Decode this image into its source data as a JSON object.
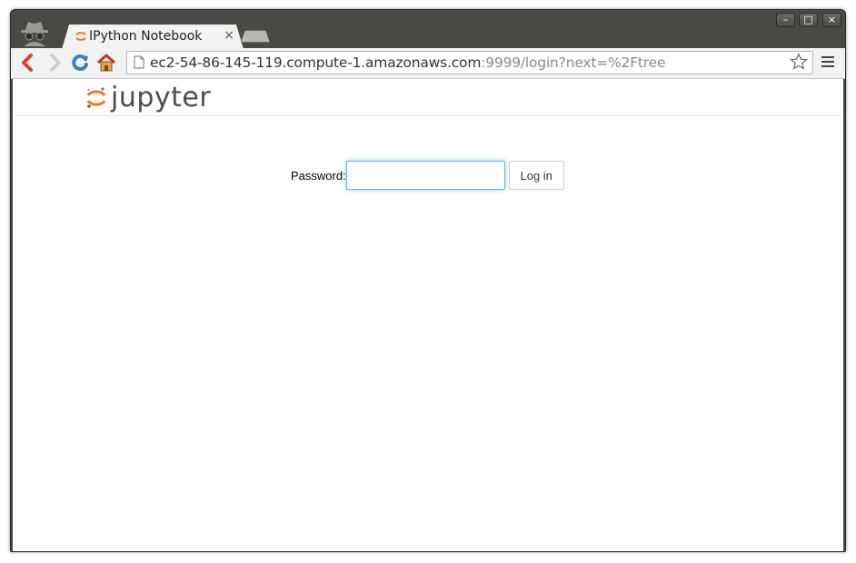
{
  "browser": {
    "tab_title": "IPython Notebook",
    "tab_close": "×",
    "url_host": "ec2-54-86-145-119.compute-1.amazonaws.com",
    "url_rest": ":9999/login?next=%2Ftree",
    "window_controls": {
      "minimize": "–",
      "maximize": "□",
      "close": "×"
    }
  },
  "page": {
    "logo_text": "jupyter",
    "password_label": "Password:",
    "password_value": "",
    "login_button": "Log in"
  },
  "colors": {
    "jupyter_orange": "#f37726",
    "focus_blue": "#66afe9",
    "titlebar": "#4a4945"
  }
}
